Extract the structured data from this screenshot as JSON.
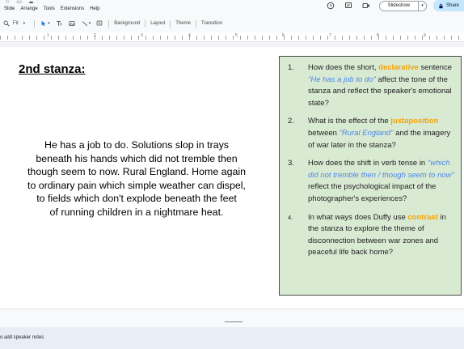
{
  "header": {
    "menus": [
      "Slide",
      "Arrange",
      "Tools",
      "Extensions",
      "Help"
    ],
    "slideshow_label": "Slideshow",
    "share_label": "Share"
  },
  "toolbar": {
    "zoom_label": "Fit",
    "background_label": "Background",
    "layout_label": "Layout",
    "theme_label": "Theme",
    "transition_label": "Transition"
  },
  "ruler": {
    "numbers": [
      "1",
      "2",
      "3",
      "4",
      "5",
      "6",
      "7",
      "8",
      "9"
    ]
  },
  "slide": {
    "title": "2nd stanza:",
    "poem_lines": [
      "He has a job to do. Solutions slop in trays",
      "beneath his hands which did not tremble then",
      "though seem to now. Rural England. Home again",
      "to ordinary pain which simple weather can dispel,",
      "to fields which don't explode beneath the feet",
      "of running children in a nightmare heat."
    ],
    "questions": [
      {
        "num": "1.",
        "parts": [
          {
            "t": "How does the short, ",
            "s": "plain"
          },
          {
            "t": "declarative",
            "s": "kw"
          },
          {
            "t": " sentence ",
            "s": "plain"
          },
          {
            "t": "\"He has a job to do\"",
            "s": "quote"
          },
          {
            "t": " affect the tone of the stanza and reflect the speaker's emotional state?",
            "s": "plain"
          }
        ]
      },
      {
        "num": "2.",
        "parts": [
          {
            "t": "What is the effect of the ",
            "s": "plain"
          },
          {
            "t": "juxtaposition",
            "s": "kw"
          },
          {
            "t": " between ",
            "s": "plain"
          },
          {
            "t": "\"Rural England\"",
            "s": "quote"
          },
          {
            "t": " and the imagery of war later in the stanza?",
            "s": "plain"
          }
        ]
      },
      {
        "num": "3.",
        "parts": [
          {
            "t": "How does the shift in verb tense in ",
            "s": "plain"
          },
          {
            "t": "\"which did not tremble then / though seem to now\"",
            "s": "quote"
          },
          {
            "t": " reflect the psychological impact of the photographer's experiences?",
            "s": "plain"
          }
        ]
      },
      {
        "num": "4.",
        "parts": [
          {
            "t": "In what ways does Duffy use ",
            "s": "plain"
          },
          {
            "t": "contrast",
            "s": "kw"
          },
          {
            "t": " in the stanza to explore the theme of disconnection between war zones and peaceful life back home?",
            "s": "plain"
          }
        ]
      }
    ]
  },
  "notes": {
    "placeholder": "o add speaker notes"
  },
  "colors": {
    "keyword": "#f6a200",
    "quote": "#4a86e8",
    "box_bg": "#d9ead3",
    "share_bg": "#c2e7ff"
  }
}
